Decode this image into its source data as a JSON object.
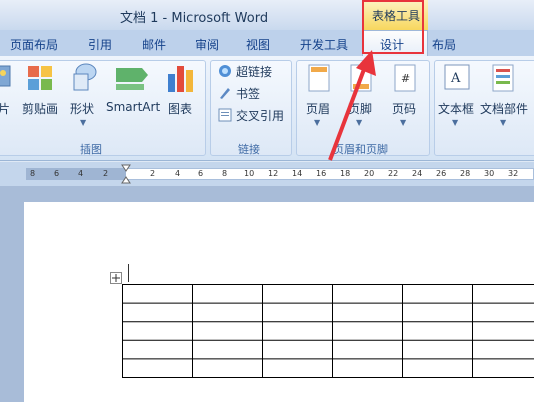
{
  "window": {
    "title": "文档 1 - Microsoft Word"
  },
  "context_tab": {
    "label": "表格工具"
  },
  "tabs": [
    {
      "label": "页面布局"
    },
    {
      "label": "引用"
    },
    {
      "label": "邮件"
    },
    {
      "label": "审阅"
    },
    {
      "label": "视图"
    },
    {
      "label": "开发工具"
    },
    {
      "label": "设计"
    },
    {
      "label": "布局"
    }
  ],
  "groups": {
    "illustrations": {
      "label": "插图",
      "buttons": [
        {
          "label": "片",
          "icon": "picture-icon"
        },
        {
          "label": "剪贴画",
          "icon": "clipart-icon"
        },
        {
          "label": "形状",
          "icon": "shapes-icon"
        },
        {
          "label": "SmartArt",
          "icon": "smartart-icon"
        },
        {
          "label": "图表",
          "icon": "chart-icon"
        }
      ]
    },
    "links": {
      "label": "链接",
      "buttons": [
        {
          "label": "超链接",
          "icon": "hyperlink-icon"
        },
        {
          "label": "书签",
          "icon": "bookmark-icon"
        },
        {
          "label": "交叉引用",
          "icon": "cross-reference-icon"
        }
      ]
    },
    "header_footer": {
      "label": "页眉和页脚",
      "buttons": [
        {
          "label": "页眉",
          "icon": "header-icon"
        },
        {
          "label": "页脚",
          "icon": "footer-icon"
        },
        {
          "label": "页码",
          "icon": "page-number-icon"
        }
      ]
    },
    "text": {
      "buttons": [
        {
          "label": "文本框",
          "icon": "textbox-icon"
        },
        {
          "label": "文档部件",
          "icon": "quickparts-icon"
        }
      ]
    }
  },
  "ruler": {
    "ticks": [
      "8",
      "6",
      "4",
      "2",
      "2",
      "4",
      "6",
      "8",
      "10",
      "12",
      "14",
      "16",
      "18",
      "20",
      "22",
      "24",
      "26",
      "28",
      "30",
      "32"
    ]
  },
  "table": {
    "rows": 5,
    "cols": 6
  },
  "colors": {
    "highlight": "#e8343c",
    "tab_text": "#15428b"
  }
}
